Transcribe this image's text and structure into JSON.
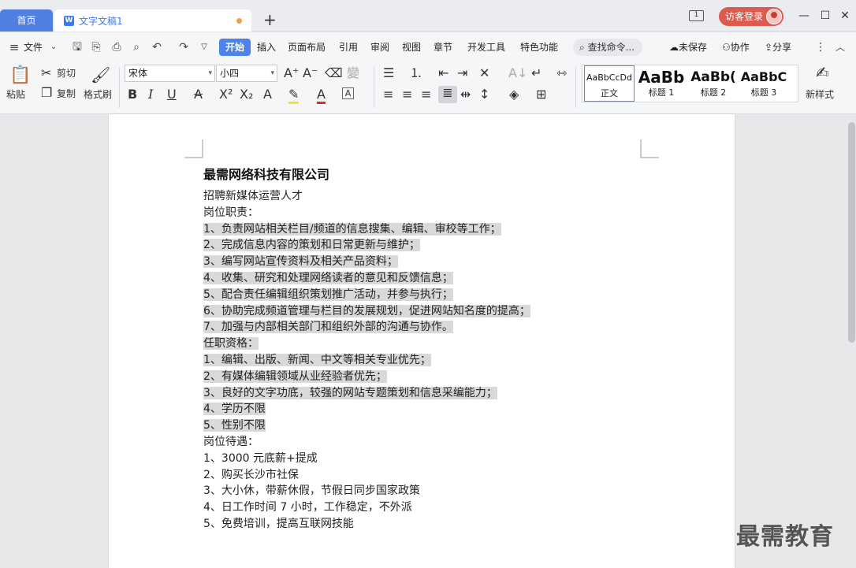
{
  "titlebar": {
    "home_tab": "首页",
    "doc_tab": "文字文稿1",
    "doc_icon": "W",
    "new_tab": "+",
    "page_indicator": "1",
    "login": "访客登录",
    "minimize": "—",
    "maximize": "☐",
    "close": "✕"
  },
  "menubar": {
    "file": "文件",
    "items": [
      "开始",
      "插入",
      "页面布局",
      "引用",
      "审阅",
      "视图",
      "章节",
      "开发工具",
      "特色功能"
    ],
    "search_placeholder": "查找命令...",
    "unsaved": "未保存",
    "collab": "协作",
    "share": "分享"
  },
  "ribbon": {
    "paste": "粘贴",
    "cut": "剪切",
    "copy": "复制",
    "format_painter": "格式刷",
    "font_name": "宋体",
    "font_size": "小四",
    "styles": [
      {
        "preview": "AaBbCcDd",
        "label": "正文"
      },
      {
        "preview": "AaBb",
        "label": "标题 1"
      },
      {
        "preview": "AaBb(",
        "label": "标题 2"
      },
      {
        "preview": "AaBbC",
        "label": "标题 3"
      }
    ],
    "new_style": "新样式"
  },
  "document": {
    "company": "最需网络科技有限公司",
    "lines": [
      "招聘新媒体运营人才",
      "岗位职责：",
      "1、负责网站相关栏目/频道的信息搜集、编辑、审校等工作；",
      "2、完成信息内容的策划和日常更新与维护；",
      "3、编写网站宣传资料及相关产品资料；",
      "4、收集、研究和处理网络读者的意见和反馈信息；",
      "5、配合责任编辑组织策划推广活动，并参与执行；",
      "6、协助完成频道管理与栏目的发展规划，促进网站知名度的提高；",
      "7、加强与内部相关部门和组织外部的沟通与协作。",
      "任职资格：",
      "1、编辑、出版、新闻、中文等相关专业优先；",
      "2、有媒体编辑领域从业经验者优先；",
      "3、良好的文字功底，较强的网站专题策划和信息采编能力；",
      "4、学历不限",
      "5、性别不限",
      "岗位待遇：",
      "1、3000 元底薪+提成",
      "2、购买长沙市社保",
      "3、大小休，带薪休假，节假日同步国家政策",
      "4、日工作时间 7 小时，工作稳定，不外派",
      "5、免费培训，提高互联网技能"
    ]
  },
  "watermark": "最需教育"
}
